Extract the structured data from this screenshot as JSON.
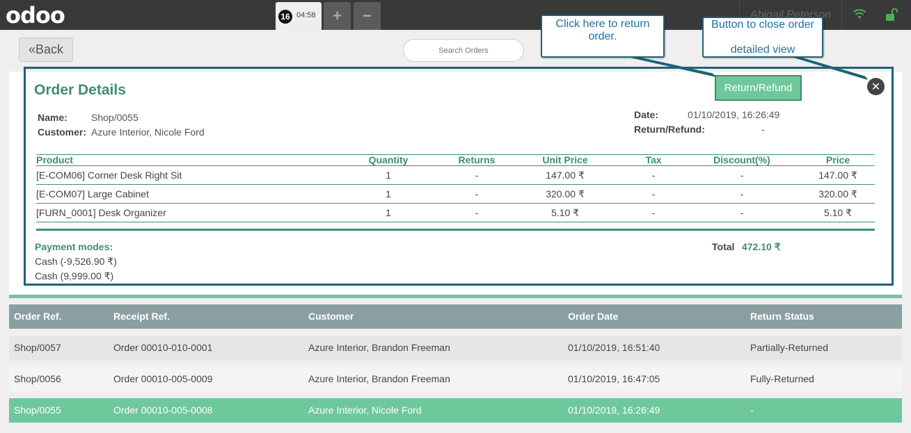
{
  "app": {
    "logo": "odoo"
  },
  "navbar": {
    "order_number": "16",
    "order_time": "04:58",
    "add_label": "+",
    "remove_label": "−",
    "user_name": "Abigail Peterson",
    "icons": [
      "wifi-icon",
      "lock-icon"
    ],
    "accent_color": "#4caf50"
  },
  "controls": {
    "back_label": "Back",
    "search_placeholder": "Search Orders"
  },
  "details": {
    "title": "Order Details",
    "name_label": "Name:",
    "name_value": "Shop/0055",
    "customer_label": "Customer:",
    "customer_value": "Azure Interior, Nicole Ford",
    "date_label": "Date:",
    "date_value": "01/10/2019, 16:26:49",
    "return_label": "Return/Refund:",
    "return_value": "-",
    "refund_button": "Return/Refund",
    "close_icon": "close-icon",
    "columns": [
      "Product",
      "Quantity",
      "Returns",
      "Unit Price",
      "Tax",
      "Discount(%)",
      "Price"
    ],
    "lines": [
      {
        "product": "[E-COM06] Corner Desk Right Sit",
        "qty": "1",
        "returns": "-",
        "unit_price": "147.00 ₹",
        "tax": "-",
        "discount": "-",
        "price": "147.00 ₹"
      },
      {
        "product": "[E-COM07] Large Cabinet",
        "qty": "1",
        "returns": "-",
        "unit_price": "320.00 ₹",
        "tax": "-",
        "discount": "-",
        "price": "320.00 ₹"
      },
      {
        "product": "[FURN_0001] Desk Organizer",
        "qty": "1",
        "returns": "-",
        "unit_price": "5.10 ₹",
        "tax": "-",
        "discount": "-",
        "price": "5.10 ₹"
      }
    ],
    "payment_title": "Payment modes:",
    "payments": [
      "Cash (-9,526.90 ₹)",
      "Cash (9,999.00 ₹)"
    ],
    "total_label": "Total",
    "total_value": "472.10 ₹"
  },
  "tooltips": {
    "return_tip": "Click here to return order.",
    "close_tip_line1": "Button to close order",
    "close_tip_line2": "detailed view"
  },
  "orders": {
    "columns": [
      "Order Ref.",
      "Receipt Ref.",
      "Customer",
      "Order Date",
      "Return Status"
    ],
    "rows": [
      {
        "ref": "Shop/0057",
        "receipt": "Order 00010-010-0001",
        "customer": "Azure Interior, Brandon Freeman",
        "date": "01/10/2019, 16:51:40",
        "status": "Partially-Returned"
      },
      {
        "ref": "Shop/0056",
        "receipt": "Order 00010-005-0009",
        "customer": "Azure Interior, Brandon Freeman",
        "date": "01/10/2019, 16:47:05",
        "status": "Fully-Returned"
      },
      {
        "ref": "Shop/0055",
        "receipt": "Order 00010-005-0008",
        "customer": "Azure Interior, Nicole Ford",
        "date": "01/10/2019, 16:26:49",
        "status": "-"
      }
    ]
  }
}
